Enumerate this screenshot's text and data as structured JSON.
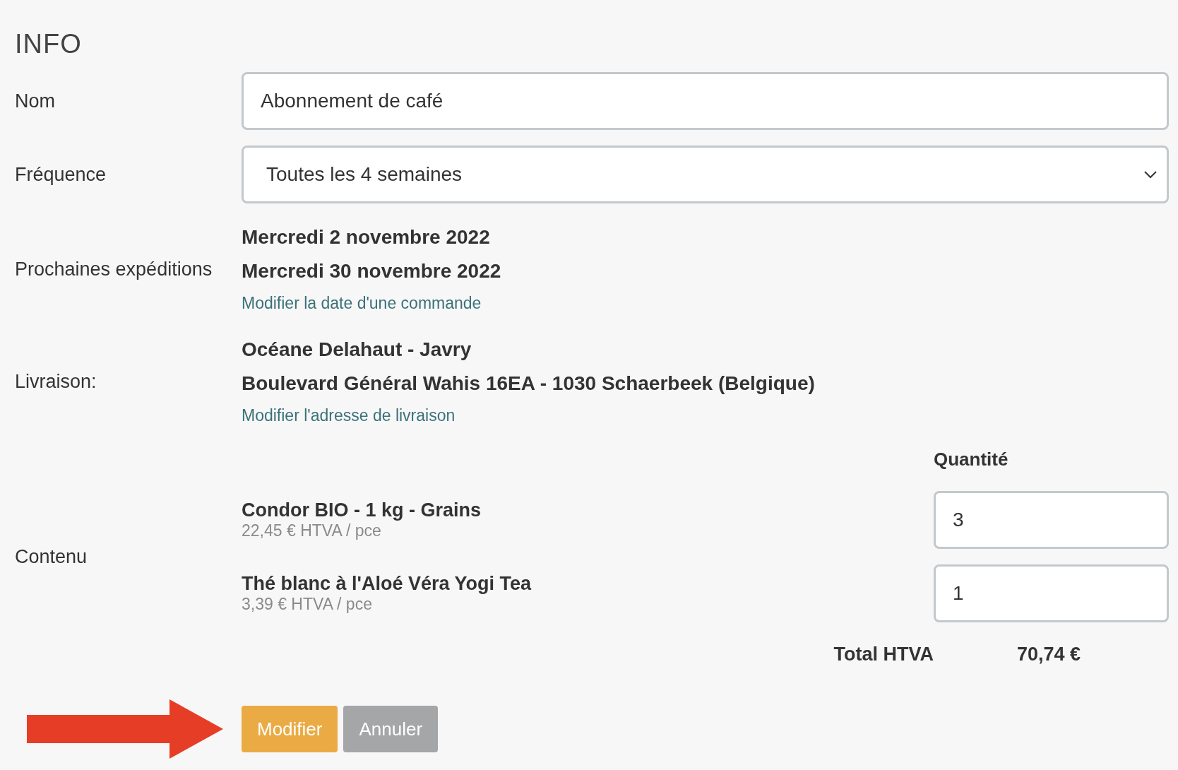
{
  "title": "INFO",
  "name": {
    "label": "Nom",
    "value": "Abonnement de café"
  },
  "frequency": {
    "label": "Fréquence",
    "value": "Toutes les 4 semaines"
  },
  "shipments": {
    "label": "Prochaines expéditions",
    "dates": [
      "Mercredi 2 novembre 2022",
      "Mercredi 30 novembre 2022"
    ],
    "link": "Modifier la date d'une commande"
  },
  "delivery": {
    "label": "Livraison:",
    "lines": [
      "Océane Delahaut - Javry",
      "Boulevard Général Wahis 16EA - 1030 Schaerbeek (Belgique)"
    ],
    "link": "Modifier l'adresse de livraison"
  },
  "content": {
    "label": "Contenu",
    "quantity_header": "Quantité",
    "items": [
      {
        "name": "Condor BIO - 1 kg - Grains",
        "price": "22,45 € HTVA / pce",
        "quantity": "3"
      },
      {
        "name": "Thé blanc à l'Aloé Véra Yogi Tea",
        "price": "3,39 € HTVA / pce",
        "quantity": "1"
      }
    ],
    "total_label": "Total HTVA",
    "total": "70,74 €"
  },
  "buttons": [
    {
      "label": "Modifier",
      "kind": "primary"
    },
    {
      "label": "Annuler",
      "kind": "secondary"
    }
  ]
}
